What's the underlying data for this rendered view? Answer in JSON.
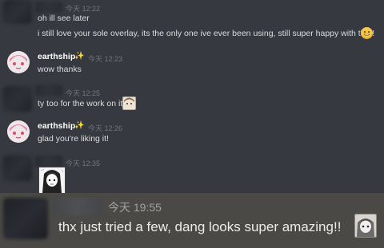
{
  "messages": [
    {
      "timestamp": "今天 12:22",
      "lines": [
        "oh ill see later",
        "i still love your sole overlay, its the only one ive ever been using, still super happy with that!"
      ],
      "emoji": "grin-emoji"
    },
    {
      "author": "earthship",
      "badge": "✨",
      "timestamp": "今天 12:23",
      "lines": [
        "wow thanks"
      ]
    },
    {
      "timestamp": "今天 12:25",
      "lines": [
        "ty too for the work on it"
      ],
      "emoji": "anime-emote"
    },
    {
      "author": "earthship",
      "badge": "✨",
      "timestamp": "今天 12:26",
      "lines": [
        "glad you're liking it!"
      ]
    },
    {
      "timestamp": "今天 12:35",
      "image": "manga-sticker"
    },
    {
      "timestamp": "今天 19:55",
      "lines": [
        "thx just tried a few, dang looks super amazing!!"
      ],
      "emoji": "anime-emote",
      "highlighted": true
    }
  ],
  "colors": {
    "background": "#36393f",
    "highlight": "#4a4945",
    "timestamp": "#72767d",
    "text": "#dcddde"
  }
}
